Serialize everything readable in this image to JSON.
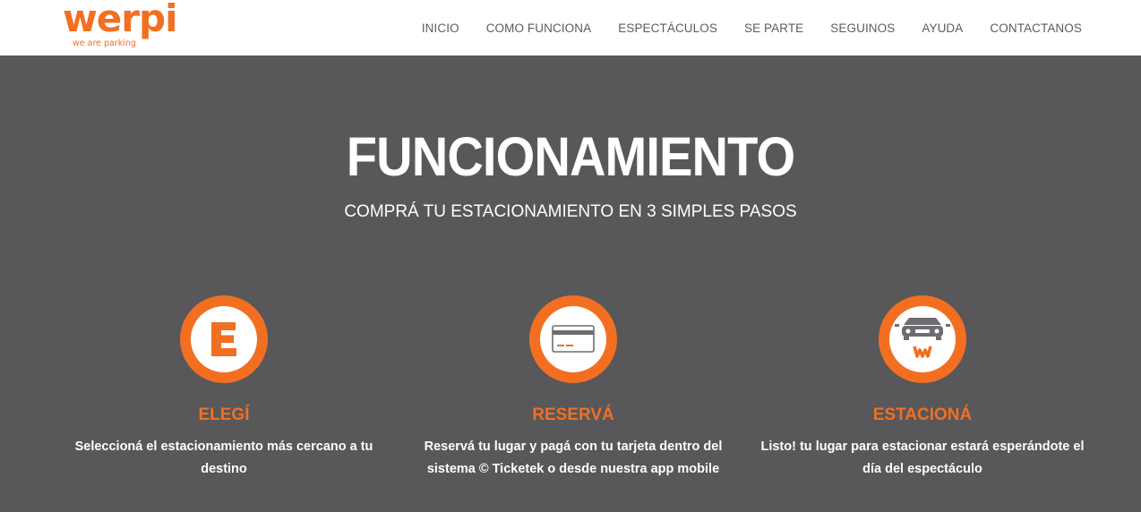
{
  "brand": {
    "logo_text": "werpi",
    "tagline": "we are parking",
    "accent_color": "#f26f21"
  },
  "nav": {
    "items": [
      {
        "label": "INICIO"
      },
      {
        "label": "COMO FUNCIONA"
      },
      {
        "label": "ESPECTÁCULOS"
      },
      {
        "label": "SE PARTE"
      },
      {
        "label": "SEGUINOS"
      },
      {
        "label": "AYUDA"
      },
      {
        "label": "CONTACTANOS"
      }
    ]
  },
  "hero": {
    "title": "FUNCIONAMIENTO",
    "subtitle": "COMPRÁ TU ESTACIONAMIENTO EN 3 SIMPLES PASOS",
    "background_color": "#58575a"
  },
  "steps": [
    {
      "icon": "parking-e-icon",
      "title": "ELEGÍ",
      "description": "Seleccioná el estacionamiento más cercano a tu destino"
    },
    {
      "icon": "credit-card-icon",
      "title": "RESERVÁ",
      "description": "Reservá tu lugar y pagá con tu tarjeta dentro del sistema © Ticketek o desde nuestra app mobile"
    },
    {
      "icon": "car-icon",
      "title": "ESTACIONÁ",
      "description": "Listo! tu lugar para estacionar estará esperándote el día del espectáculo"
    }
  ]
}
